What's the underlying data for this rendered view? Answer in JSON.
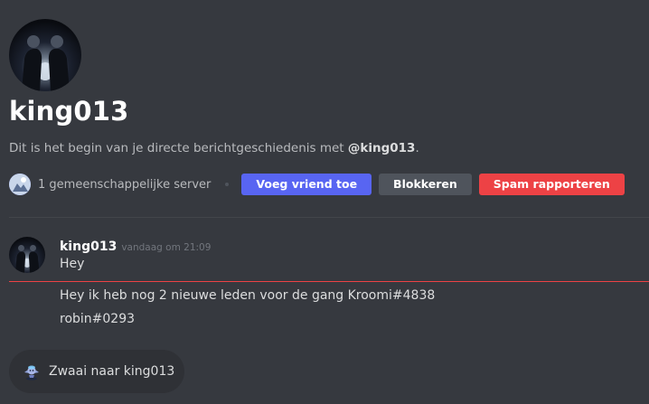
{
  "profile": {
    "username": "king013"
  },
  "intro": {
    "text": "Dit is het begin van je directe berichtgeschiedenis met ",
    "mention": "@king013",
    "suffix": "."
  },
  "actions": {
    "mutual_servers": "1 gemeenschappelijke server",
    "add_friend_label": "Voeg vriend toe",
    "block_label": "Blokkeren",
    "report_spam_label": "Spam rapporteren"
  },
  "messages": [
    {
      "author": "king013",
      "timestamp": "vandaag om 21:09",
      "text": "Hey"
    }
  ],
  "new_messages": [
    {
      "text": "Hey ik heb nog 2 nieuwe leden voor de gang Kroomi#4838"
    },
    {
      "text": "robin#0293"
    }
  ],
  "wave": {
    "label": "Zwaai naar king013",
    "icon": "wave-sticker-icon"
  },
  "colors": {
    "background": "#36393f",
    "brand": "#5865f2",
    "danger": "#ed4245",
    "secondary_button": "#4f545c",
    "wave_pill": "#2f3136"
  }
}
